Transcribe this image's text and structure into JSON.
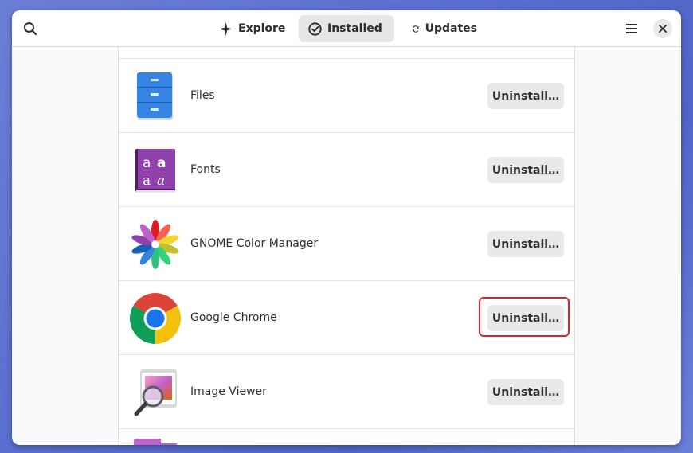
{
  "tabs": [
    {
      "label": "Explore",
      "icon": "explore-icon",
      "active": false
    },
    {
      "label": "Installed",
      "icon": "check-icon",
      "active": true
    },
    {
      "label": "Updates",
      "icon": "refresh-icon",
      "active": false
    }
  ],
  "header": {
    "search_icon": "search-icon",
    "menu_icon": "hamburger-menu-icon",
    "close_icon": "close-icon"
  },
  "apps": [
    {
      "name": "Files",
      "icon": "files-icon",
      "button": "Uninstall…"
    },
    {
      "name": "Fonts",
      "icon": "fonts-icon",
      "button": "Uninstall…"
    },
    {
      "name": "GNOME Color Manager",
      "icon": "color-manager-icon",
      "button": "Uninstall…"
    },
    {
      "name": "Google Chrome",
      "icon": "chrome-icon",
      "button": "Uninstall…",
      "highlighted": true
    },
    {
      "name": "Image Viewer",
      "icon": "image-viewer-icon",
      "button": "Uninstall…"
    }
  ],
  "colors": {
    "highlight": "#e0202a",
    "active_tab": "#e6e6e6",
    "button": "#e9e9e9"
  }
}
